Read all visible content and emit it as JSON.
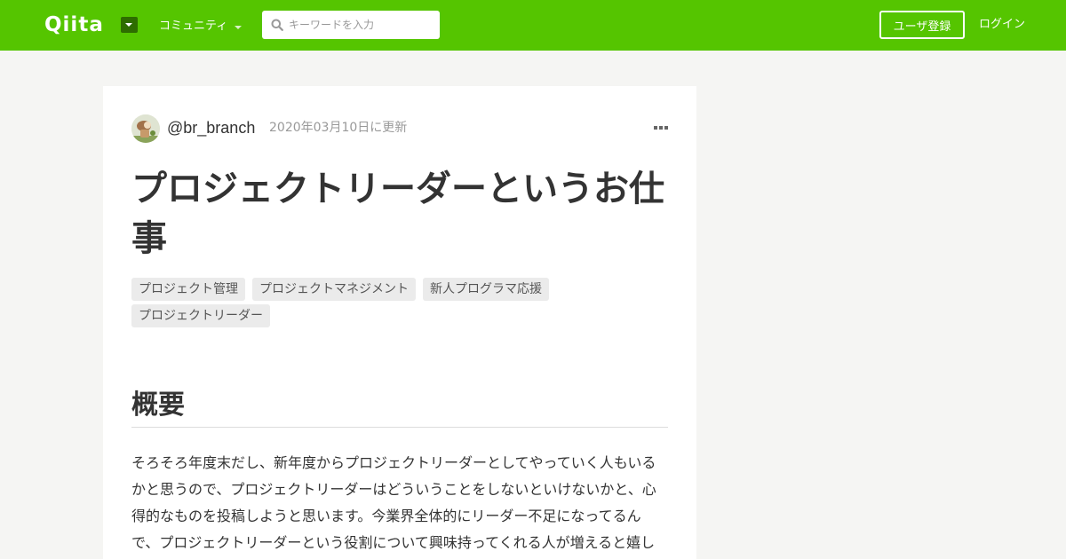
{
  "header": {
    "logo_text": "Qiita",
    "community_label": "コミュニティ",
    "search_placeholder": "キーワードを入力",
    "signup_label": "ユーザ登録",
    "login_label": "ログイン",
    "brand_color": "#55c500"
  },
  "article": {
    "author": "@br_branch",
    "updated": "2020年03月10日に更新",
    "title": "プロジェクトリーダーというお仕事",
    "tags": [
      "プロジェクト管理",
      "プロジェクトマネジメント",
      "新人プログラマ応援",
      "プロジェクトリーダー"
    ],
    "section_heading": "概要",
    "body": "そろそろ年度末だし、新年度からプロジェクトリーダーとしてやっていく人もいるかと思うので、プロジェクトリーダーはどういうことをしないといけないかと、心得的なものを投稿しようと思います。今業界全体的にリーダー不足になってるんで、プロジェクトリーダーという役割について興味持ってくれる人が増えると嬉し"
  },
  "icons": {
    "logo_dropdown": "chevron-down-icon",
    "community_caret": "caret-down-icon",
    "search": "search-icon",
    "more": "more-horizontal-icon",
    "avatar": "avatar"
  }
}
